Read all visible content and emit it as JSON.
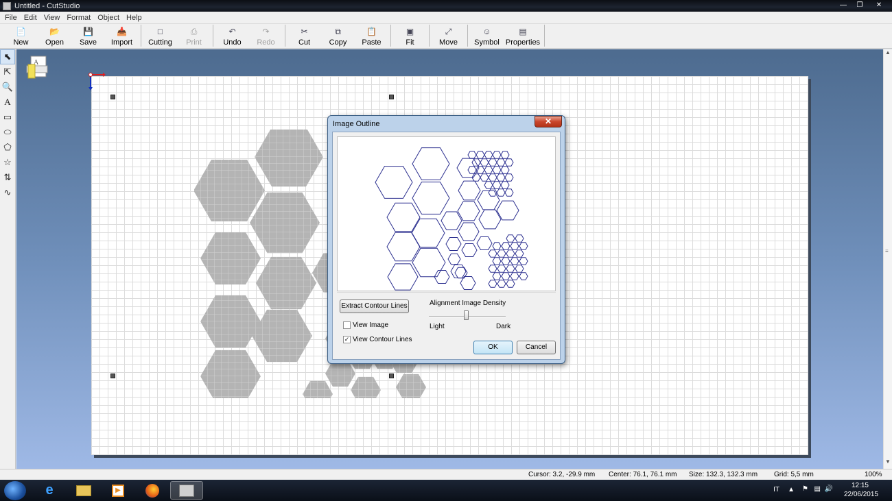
{
  "window": {
    "title": "Untitled - CutStudio"
  },
  "menu": [
    "File",
    "Edit",
    "View",
    "Format",
    "Object",
    "Help"
  ],
  "toolbar": [
    {
      "label": "New",
      "icon": "new-file-icon",
      "enabled": true
    },
    {
      "label": "Open",
      "icon": "open-folder-icon",
      "enabled": true
    },
    {
      "label": "Save",
      "icon": "save-disk-icon",
      "enabled": true
    },
    {
      "label": "Import",
      "icon": "import-icon",
      "enabled": true
    },
    {
      "label": "Cutting",
      "icon": "cutting-machine-icon",
      "enabled": true
    },
    {
      "label": "Print",
      "icon": "printer-icon",
      "enabled": false
    },
    {
      "label": "Undo",
      "icon": "undo-icon",
      "enabled": true
    },
    {
      "label": "Redo",
      "icon": "redo-icon",
      "enabled": false
    },
    {
      "label": "Cut",
      "icon": "scissors-icon",
      "enabled": true
    },
    {
      "label": "Copy",
      "icon": "copy-icon",
      "enabled": true
    },
    {
      "label": "Paste",
      "icon": "paste-icon",
      "enabled": true
    },
    {
      "label": "Fit",
      "icon": "fit-icon",
      "enabled": true
    },
    {
      "label": "Move",
      "icon": "move-icon",
      "enabled": true
    },
    {
      "label": "Symbol",
      "icon": "symbol-icon",
      "enabled": true
    },
    {
      "label": "Properties",
      "icon": "properties-icon",
      "enabled": true
    }
  ],
  "tools": [
    "select-arrow-icon",
    "node-edit-icon",
    "zoom-icon",
    "text-tool-icon",
    "rectangle-icon",
    "ellipse-icon",
    "polygon-icon",
    "star-icon",
    "polyline-icon",
    "curve-icon"
  ],
  "dialog": {
    "title": "Image Outline",
    "extract_button": "Extract Contour Lines",
    "view_image_label": "View Image",
    "view_image_checked": false,
    "view_contour_label": "View Contour Lines",
    "view_contour_checked": true,
    "density_label": "Alignment Image Density",
    "light_label": "Light",
    "dark_label": "Dark",
    "ok_label": "OK",
    "cancel_label": "Cancel"
  },
  "status": {
    "cursor": "Cursor: 3.2, -29.9 mm",
    "center": "Center: 76.1, 76.1 mm",
    "size": "Size: 132.3, 132.3 mm",
    "grid": "Grid: 5,5 mm",
    "zoom": "100%"
  },
  "taskbar": {
    "language": "IT",
    "time": "12:15",
    "date": "22/06/2015"
  },
  "colors": {
    "contour": "#2b2f8f",
    "shape_fill": "#b4b4b4",
    "workspace": "#6f8fba"
  }
}
